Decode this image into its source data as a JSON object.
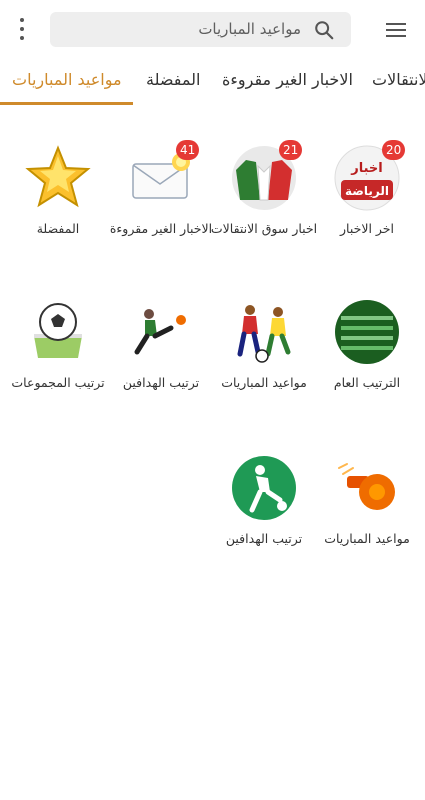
{
  "search": {
    "placeholder": "مواعيد المباريات"
  },
  "tabs": [
    {
      "label": "مواعيد المباريات",
      "active": true
    },
    {
      "label": "المفضلة",
      "active": false
    },
    {
      "label": "الاخبار الغير مقروءة",
      "active": false
    },
    {
      "label": "الانتقالات",
      "active": false
    }
  ],
  "tiles": [
    {
      "icon": "sports-news-logo-icon",
      "label": "اخر الاخبار",
      "badge": "20",
      "overlay": "اخبار الرياضة"
    },
    {
      "icon": "transfer-jerseys-icon",
      "label": "اخبار سوق الانتقالات",
      "badge": "21"
    },
    {
      "icon": "unread-mail-icon",
      "label": "الاخبار الغير مقروءة",
      "badge": "41"
    },
    {
      "icon": "favorite-star-icon",
      "label": "المفضلة"
    },
    {
      "icon": "football-pitch-icon",
      "label": "الترتيب العام"
    },
    {
      "icon": "football-players-icon",
      "label": "مواعيد المباريات"
    },
    {
      "icon": "player-kicking-icon",
      "label": "ترتيب الهدافين"
    },
    {
      "icon": "ball-trophy-icon",
      "label": "ترتيب المجموعات"
    },
    {
      "icon": "referee-whistle-icon",
      "label": "مواعيد المباريات"
    },
    {
      "icon": "scorer-silhouette-icon",
      "label": "ترتيب الهدافين"
    }
  ],
  "colors": {
    "accent": "#cf8a2b",
    "badge": "#e53935",
    "green": "#1f9a55"
  }
}
